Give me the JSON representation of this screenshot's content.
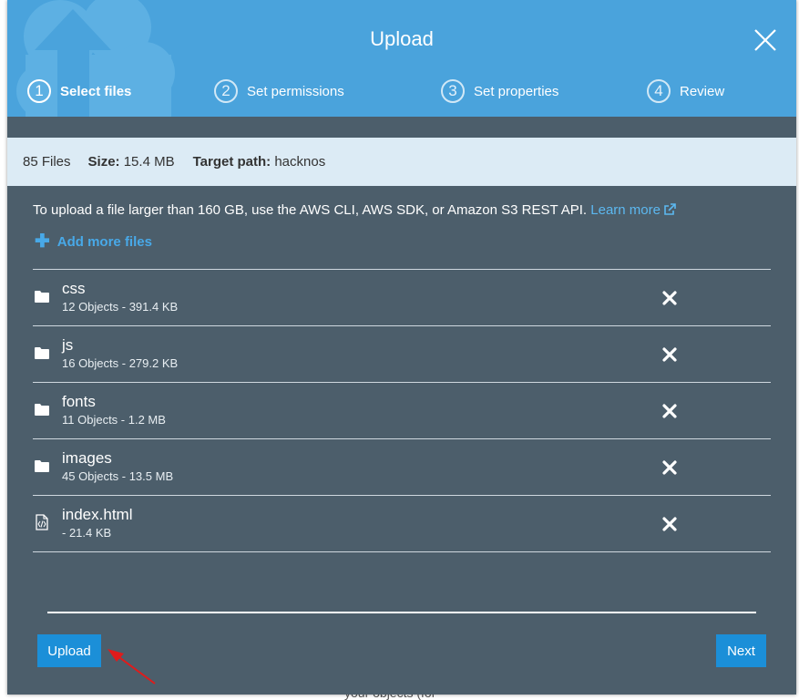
{
  "background": {
    "text": "your objects (for"
  },
  "header": {
    "title": "Upload",
    "steps": [
      {
        "number": "1",
        "label": "Select files",
        "active": true
      },
      {
        "number": "2",
        "label": "Set permissions",
        "active": false
      },
      {
        "number": "3",
        "label": "Set properties",
        "active": false
      },
      {
        "number": "4",
        "label": "Review",
        "active": false
      }
    ]
  },
  "summary": {
    "files": "85 Files",
    "size_label": "Size:",
    "size_value": "15.4 MB",
    "target_label": "Target path:",
    "target_value": "hacknos"
  },
  "info": {
    "text": "To upload a file larger than 160 GB, use the AWS CLI, AWS SDK, or Amazon S3 REST API.",
    "link": "Learn more"
  },
  "add_more": "Add more files",
  "files": [
    {
      "name": "css",
      "meta": "12 Objects - 391.4 KB",
      "icon": "folder-icon"
    },
    {
      "name": "js",
      "meta": "16 Objects - 279.2 KB",
      "icon": "folder-icon"
    },
    {
      "name": "fonts",
      "meta": "11 Objects - 1.2 MB",
      "icon": "folder-icon"
    },
    {
      "name": "images",
      "meta": "45 Objects - 13.5 MB",
      "icon": "folder-icon"
    },
    {
      "name": "index.html",
      "meta": "- 21.4 KB",
      "icon": "code-file-icon"
    }
  ],
  "buttons": {
    "upload": "Upload",
    "next": "Next"
  },
  "colors": {
    "header": "#4aa3dc",
    "body": "#4c5e6b",
    "summary": "#dcebf5",
    "button": "#1b8fd8",
    "link": "#5cb8f0",
    "annotation_arrow": "#e01b1b"
  }
}
